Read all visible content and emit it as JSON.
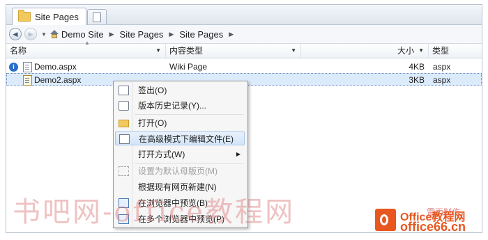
{
  "tabs": {
    "active_label": "Site Pages"
  },
  "breadcrumb": [
    "Demo Site",
    "Site Pages",
    "Site Pages"
  ],
  "columns": {
    "name": "名称",
    "content_type": "内容类型",
    "size": "大小",
    "type": "类型"
  },
  "rows": [
    {
      "name": "Demo.aspx",
      "content_type": "Wiki Page",
      "size": "4KB",
      "type": "aspx"
    },
    {
      "name": "Demo2.aspx",
      "content_type": "",
      "size": "3KB",
      "type": "aspx"
    }
  ],
  "context_menu": {
    "checkout": "签出(O)",
    "version_history": "版本历史记录(Y)...",
    "open": "打开(O)",
    "edit_advanced": "在高级模式下编辑文件(E)",
    "open_with": "打开方式(W)",
    "set_default_master": "设置为默认母版页(M)",
    "new_from_existing": "根据现有网页新建(N)",
    "preview_browser": "在浏览器中预览(B)",
    "preview_multi": "在多个浏览器中预览(P)"
  },
  "watermark": {
    "text": "书吧网-office教程网",
    "credit": "雷雨制作",
    "logo_line1": "Office教程网",
    "logo_line2": "office66.cn"
  },
  "colors": {
    "accent": "#e8571f",
    "selection": "#dcebfc"
  }
}
